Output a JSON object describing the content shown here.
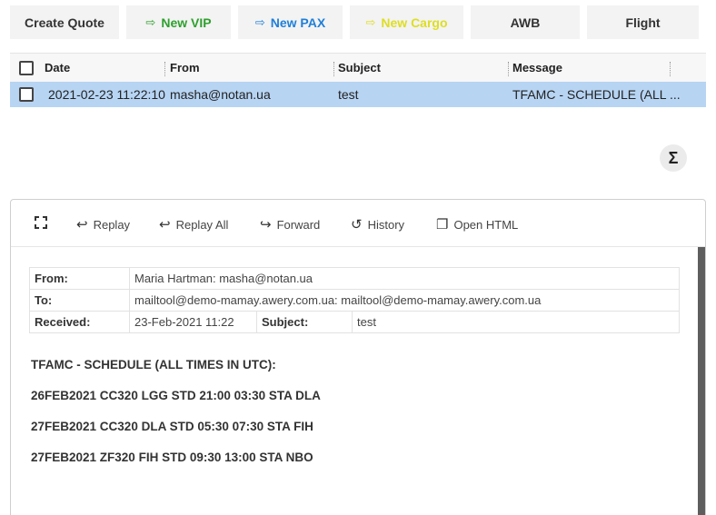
{
  "toolbar": {
    "create_quote": "Create Quote",
    "new_vip": "New VIP",
    "new_pax": "New PAX",
    "new_cargo": "New Cargo",
    "awb": "AWB",
    "flight": "Flight"
  },
  "grid": {
    "columns": [
      "Date",
      "From",
      "Subject",
      "Message"
    ],
    "rows": [
      {
        "date": "2021-02-23 11:22:10",
        "from": "masha@notan.ua",
        "subject": "test",
        "message": "TFAMC - SCHEDULE (ALL ..."
      }
    ]
  },
  "sigma": "Σ",
  "message_toolbar": {
    "replay": "Replay",
    "replay_all": "Replay All",
    "forward": "Forward",
    "history": "History",
    "open_html": "Open HTML"
  },
  "header": {
    "from_label": "From:",
    "from_value": "Maria Hartman: masha@notan.ua",
    "to_label": "To:",
    "to_value": "mailtool@demo-mamay.awery.com.ua: mailtool@demo-mamay.awery.com.ua",
    "received_label": "Received:",
    "received_value": "23-Feb-2021 11:22",
    "subject_label": "Subject:",
    "subject_value": "test"
  },
  "body": [
    "TFAMC - SCHEDULE (ALL TIMES IN UTC):",
    "26FEB2021 CC320 LGG STD 21:00 03:30 STA DLA",
    "27FEB2021 CC320 DLA STD 05:30 07:30 STA FIH",
    "27FEB2021 ZF320 FIH STD 09:30 13:00 STA NBO"
  ]
}
